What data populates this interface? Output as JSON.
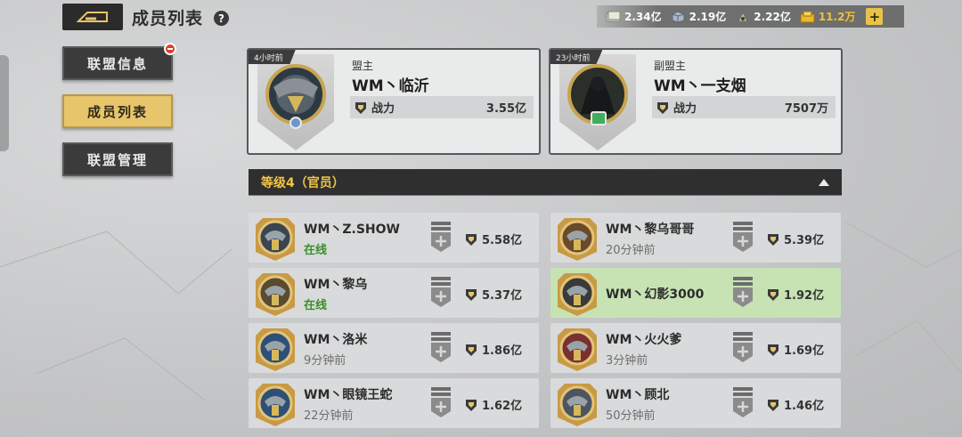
{
  "header": {
    "title": "成员列表",
    "help": "?"
  },
  "resources": [
    {
      "icon": "cash-icon",
      "value": "2.34亿"
    },
    {
      "icon": "steel-icon",
      "value": "2.19亿"
    },
    {
      "icon": "oil-icon",
      "value": "2.22亿"
    },
    {
      "icon": "gold-icon",
      "value": "11.2万"
    }
  ],
  "plus": "+",
  "menu": [
    {
      "label": "联盟信息",
      "badge": true
    },
    {
      "label": "成员列表",
      "active": true
    },
    {
      "label": "联盟管理"
    }
  ],
  "leaders": [
    {
      "time": "4小时前",
      "role": "盟主",
      "name": "WM丶临沂",
      "power_label": "战力",
      "power": "3.55亿"
    },
    {
      "time": "23小时前",
      "role": "副盟主",
      "name": "WM丶一支烟",
      "power_label": "战力",
      "power": "7507万"
    }
  ],
  "section": {
    "title": "等级4（官员）"
  },
  "members": [
    {
      "name": "WM丶Z.SHOW",
      "status": "在线",
      "online": true,
      "power": "5.58亿"
    },
    {
      "name": "WM丶黎乌哥哥",
      "status": "20分钟前",
      "online": false,
      "power": "5.39亿"
    },
    {
      "name": "WM丶黎乌",
      "status": "在线",
      "online": true,
      "power": "5.37亿"
    },
    {
      "name": "WM丶幻影3000",
      "status": "",
      "online": false,
      "power": "1.92亿",
      "highlight": true
    },
    {
      "name": "WM丶洛米",
      "status": "9分钟前",
      "online": false,
      "power": "1.86亿"
    },
    {
      "name": "WM丶火火爹",
      "status": "3分钟前",
      "online": false,
      "power": "1.69亿"
    },
    {
      "name": "WM丶眼镜王蛇",
      "status": "22分钟前",
      "online": false,
      "power": "1.62亿"
    },
    {
      "name": "WM丶顾北",
      "status": "50分钟前",
      "online": false,
      "power": "1.46亿"
    }
  ],
  "colors": {
    "accent_gold": "#e7c56a",
    "online_green": "#3a8f2a",
    "section_text": "#f1c545",
    "highlight_row": "#c7e3b4"
  }
}
